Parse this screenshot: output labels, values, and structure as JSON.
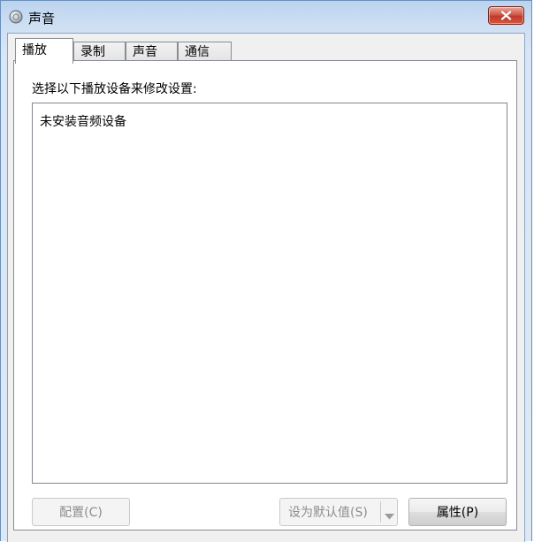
{
  "window": {
    "title": "声音",
    "app_icon": "speaker-icon",
    "close_icon": "close-icon"
  },
  "tabs": [
    {
      "label": "播放",
      "active": true
    },
    {
      "label": "录制",
      "active": false
    },
    {
      "label": "声音",
      "active": false
    },
    {
      "label": "通信",
      "active": false
    }
  ],
  "playback": {
    "instruction": "选择以下播放设备来修改设置:",
    "empty_message": "未安装音频设备"
  },
  "buttons": {
    "configure": {
      "label": "配置(C)",
      "enabled": false
    },
    "set_default": {
      "label": "设为默认值(S)",
      "enabled": false,
      "dropdown_icon": "triangle-down-icon"
    },
    "properties": {
      "label": "属性(P)",
      "enabled": true
    }
  },
  "colors": {
    "close_button": "#c0392b",
    "disabled_text": "#8d8d8d"
  }
}
